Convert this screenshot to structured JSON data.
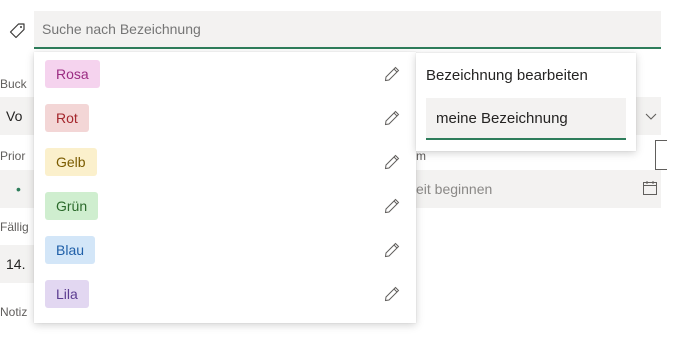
{
  "search": {
    "placeholder": "Suche nach Bezeichnung"
  },
  "background_form": {
    "bucket_label": "Buck",
    "bucket_value": "Vo",
    "priority_label": "Prior",
    "priority_value": "•",
    "start_label_fragment": "m",
    "start_placeholder_fragment": "eit beginnen",
    "due_label": "Fällig",
    "due_value": "14.",
    "notes_label": "Notiz"
  },
  "labels": [
    {
      "name": "Rosa",
      "bg": "#f5d3ee",
      "fg": "#9b2c82"
    },
    {
      "name": "Rot",
      "bg": "#f3d6d6",
      "fg": "#a4262c"
    },
    {
      "name": "Gelb",
      "bg": "#fbf0cc",
      "fg": "#7a5b00"
    },
    {
      "name": "Grün",
      "bg": "#cfeecf",
      "fg": "#2b6a2b"
    },
    {
      "name": "Blau",
      "bg": "#d3e6f8",
      "fg": "#1f5fa8"
    },
    {
      "name": "Lila",
      "bg": "#e2d7f1",
      "fg": "#5c3d91"
    }
  ],
  "edit_popup": {
    "title": "Bezeichnung bearbeiten",
    "value": "meine Bezeichnung"
  },
  "colors": {
    "accent": "#2e7d5b",
    "field_bg": "#f3f2f1"
  },
  "icons": {
    "search_field": "tag-icon",
    "edit": "pencil-icon",
    "date": "calendar-icon",
    "dropdown": "chevron-down-icon"
  }
}
